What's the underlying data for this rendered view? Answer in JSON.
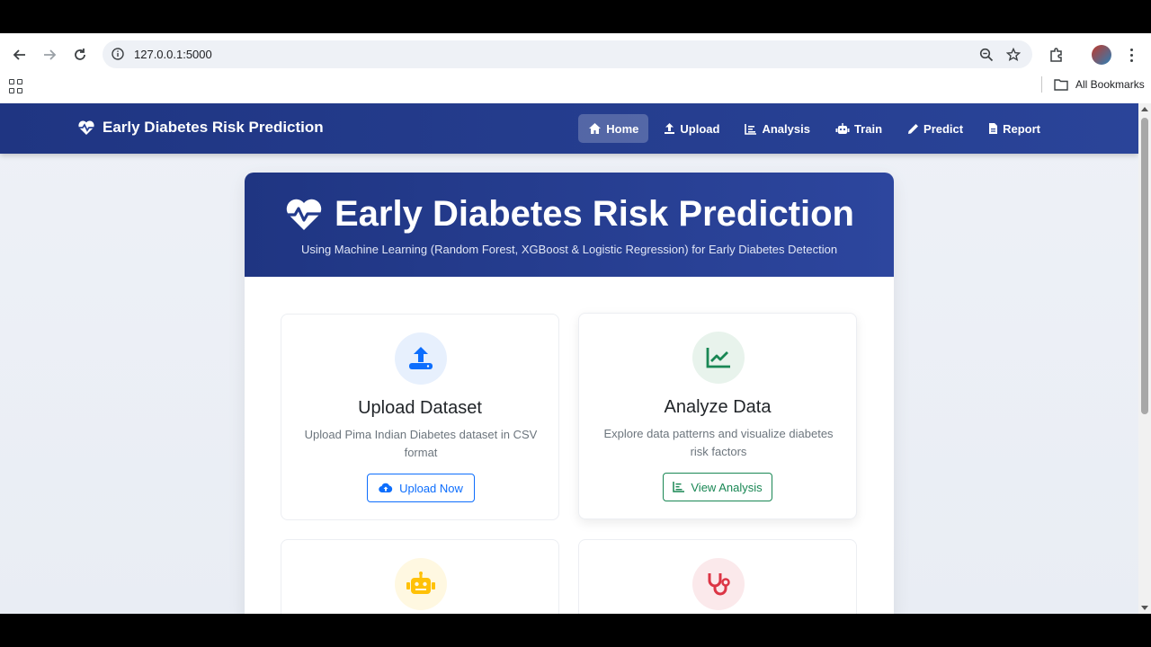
{
  "browser": {
    "url": "127.0.0.1:5000",
    "bookmarks_label": "All Bookmarks"
  },
  "navbar": {
    "brand": "Early Diabetes Risk Prediction",
    "items": [
      {
        "label": "Home",
        "icon": "home-icon",
        "active": true
      },
      {
        "label": "Upload",
        "icon": "upload-icon"
      },
      {
        "label": "Analysis",
        "icon": "chart-icon"
      },
      {
        "label": "Train",
        "icon": "robot-icon"
      },
      {
        "label": "Predict",
        "icon": "pencil-icon"
      },
      {
        "label": "Report",
        "icon": "file-icon"
      }
    ]
  },
  "hero": {
    "title": "Early Diabetes Risk Prediction",
    "subtitle": "Using Machine Learning (Random Forest, XGBoost & Logistic Regression) for Early Diabetes Detection"
  },
  "features": [
    {
      "title": "Upload Dataset",
      "desc": "Upload Pima Indian Diabetes dataset in CSV format",
      "button": "Upload Now",
      "color": "#0d6efd"
    },
    {
      "title": "Analyze Data",
      "desc": "Explore data patterns and visualize diabetes risk factors",
      "button": "View Analysis",
      "color": "#198754"
    }
  ],
  "colors": {
    "primary": "#1f3582",
    "blue": "#0d6efd",
    "green": "#198754",
    "yellow": "#ffc107",
    "red": "#dc3545"
  }
}
